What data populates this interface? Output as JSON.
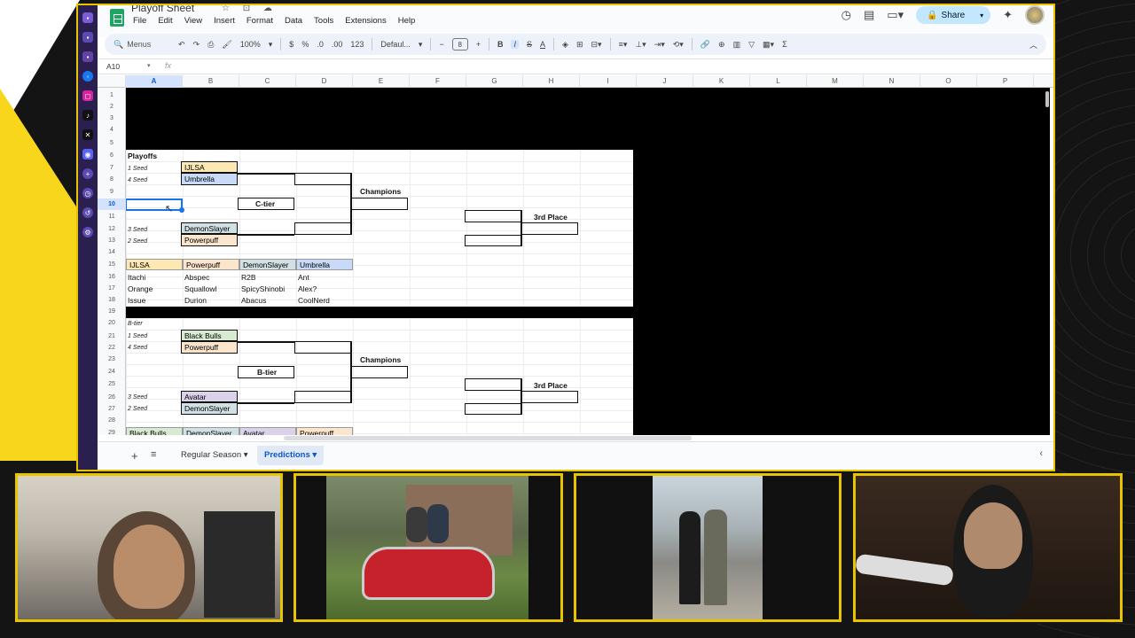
{
  "sheet": {
    "title": "Playoff Sheet",
    "menus": [
      "File",
      "Edit",
      "View",
      "Insert",
      "Format",
      "Data",
      "Tools",
      "Extensions",
      "Help"
    ],
    "share_label": "Share",
    "toolbar": {
      "search": "Menus",
      "zoom": "100%",
      "currency": "$",
      "percent": "%",
      "dec_less": ".0",
      "dec_more": ".00",
      "number_format": "123",
      "font": "Defaul...",
      "font_size": "8",
      "minus": "−",
      "plus": "+",
      "bold": "B",
      "italic": "I",
      "strike": "S",
      "text_color": "A",
      "sigma": "Σ"
    },
    "name_box": "A10",
    "fx": "fx",
    "columns": [
      "A",
      "B",
      "C",
      "D",
      "E",
      "F",
      "G",
      "H",
      "I",
      "J",
      "K",
      "L",
      "M",
      "N",
      "O",
      "P"
    ],
    "rows": [
      "1",
      "2",
      "3",
      "4",
      "5",
      "6",
      "7",
      "8",
      "9",
      "10",
      "11",
      "12",
      "13",
      "14",
      "15",
      "16",
      "17",
      "18",
      "19",
      "20",
      "21",
      "22",
      "23",
      "24",
      "25",
      "26",
      "27",
      "28",
      "29"
    ],
    "ctier": {
      "header": "Playoffs",
      "seed1": "1 Seed",
      "seed4": "4 Seed",
      "seed3": "3 Seed",
      "seed2": "2 Seed",
      "team1": "IJLSA",
      "team4": "Umbrella",
      "team3": "DemonSlayer",
      "team2": "Powerpuff",
      "tier_label": "C-tier",
      "champions": "Champions",
      "third": "3rd Place",
      "roster_heads": [
        "IJLSA",
        "Powerpuff",
        "DemonSlayer",
        "Umbrella"
      ],
      "roster": [
        [
          "Itachi",
          "Abspec",
          "R2B",
          "Ant"
        ],
        [
          "Orange",
          "Squallowl",
          "SpicyShinobi",
          "Alex?"
        ],
        [
          "Issue",
          "Durion",
          "Abacus",
          "CoolNerd"
        ]
      ]
    },
    "btier": {
      "header": "B-tier",
      "seed1": "1 Seed",
      "seed4": "4 Seed",
      "seed3": "3 Seed",
      "seed2": "2 Seed",
      "team1": "Black Bulls",
      "team4": "Powerpuff",
      "team3": "Avatar",
      "team2": "DemonSlayer",
      "tier_label": "B-tier",
      "champions": "Champions",
      "third": "3rd Place",
      "roster_heads": [
        "Black Bulls",
        "DemonSlayer",
        "Avatar",
        "Powerpuff"
      ]
    },
    "tabs": {
      "regular": "Regular Season",
      "predictions": "Predictions"
    }
  }
}
